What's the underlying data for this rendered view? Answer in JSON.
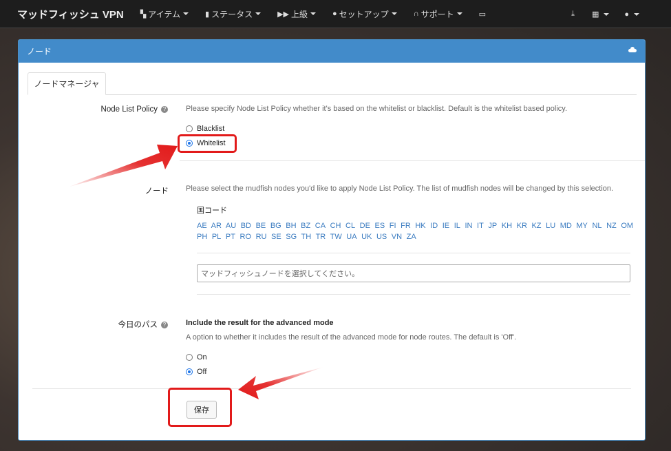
{
  "navbar": {
    "brand": "マッドフィッシュ VPN",
    "items": [
      {
        "icon": "grid-icon",
        "label": "アイテム"
      },
      {
        "icon": "bar-chart-icon",
        "label": "ステータス"
      },
      {
        "icon": "fast-forward-icon",
        "label": "上級"
      },
      {
        "icon": "user-icon",
        "label": "セットアップ"
      },
      {
        "icon": "headphones-icon",
        "label": "サポート"
      },
      {
        "icon": "keyboard-icon",
        "label": ""
      }
    ],
    "right": [
      {
        "icon": "download-icon"
      },
      {
        "icon": "apps-grid-icon"
      },
      {
        "icon": "user-icon"
      }
    ]
  },
  "panel": {
    "title": "ノード",
    "icon": "cloud-icon",
    "tab": "ノードマネージャ"
  },
  "policy": {
    "label": "Node List Policy",
    "description": "Please specify Node List Policy whether it's based on the whitelist or blacklist. Default is the whitelist based policy.",
    "options": [
      {
        "label": "Blacklist",
        "checked": false
      },
      {
        "label": "Whitelist",
        "checked": true
      }
    ]
  },
  "nodes": {
    "label": "ノード",
    "description": "Please select the mudfish nodes you'd like to apply Node List Policy. The list of mudfish nodes will be changed by this selection.",
    "country_code_label": "国コード",
    "country_codes": [
      "AE",
      "AR",
      "AU",
      "BD",
      "BE",
      "BG",
      "BH",
      "BZ",
      "CA",
      "CH",
      "CL",
      "DE",
      "ES",
      "FI",
      "FR",
      "HK",
      "ID",
      "IE",
      "IL",
      "IN",
      "IT",
      "JP",
      "KH",
      "KR",
      "KZ",
      "LU",
      "MD",
      "MY",
      "NL",
      "NZ",
      "OM",
      "PH",
      "PL",
      "PT",
      "RO",
      "RU",
      "SE",
      "SG",
      "TH",
      "TR",
      "TW",
      "UA",
      "UK",
      "US",
      "VN",
      "ZA"
    ],
    "placeholder": "マッドフィッシュノードを選択してください。"
  },
  "path": {
    "label": "今日のパス",
    "title": "Include the result for the advanced mode",
    "description": "A option to whether it includes the result of the advanced mode for node routes. The default is 'Off'.",
    "options": [
      {
        "label": "On",
        "checked": false
      },
      {
        "label": "Off",
        "checked": true
      }
    ]
  },
  "save_label": "保存",
  "colors": {
    "navbar": "#1d1d1d",
    "panel_header": "#428bca",
    "link": "#3a7bc0",
    "annotation": "#e21a1a"
  }
}
